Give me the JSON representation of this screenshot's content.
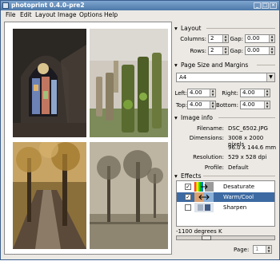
{
  "window": {
    "title": "photoprint 0.4.0-pre2",
    "buttons": {
      "minimize": "_",
      "maximize": "□",
      "close": "×"
    }
  },
  "menu": [
    "File",
    "Edit",
    "Layout",
    "Image",
    "Options",
    "Help"
  ],
  "photos": [
    {
      "caption": "stained glass window"
    },
    {
      "caption": "mossy wooden posts"
    },
    {
      "caption": "autumn woodland path"
    },
    {
      "caption": "sepia trees"
    }
  ],
  "layout": {
    "title": "Layout",
    "columns_label": "Columns:",
    "columns_value": "2",
    "rows_label": "Rows:",
    "rows_value": "2",
    "gap1_label": "Gap:",
    "gap1_value": "0.00",
    "gap2_label": "Gap:",
    "gap2_value": "0.00"
  },
  "page_size": {
    "title": "Page Size and Margins",
    "paper": "A4",
    "left_label": "Left:",
    "left_value": "4.00",
    "right_label": "Right:",
    "right_value": "4.00",
    "top_label": "Top:",
    "top_value": "4.00",
    "bottom_label": "Bottom:",
    "bottom_value": "4.00"
  },
  "image_info": {
    "title": "Image info",
    "filename_label": "Filename:",
    "filename": "DSC_6502.JPG",
    "dimensions_label": "Dimensions:",
    "dimensions_px": "3008 x 2000 pixels",
    "dimensions_mm": "96.0 x 144.6 mm",
    "resolution_label": "Resolution:",
    "resolution": "529 x 528 dpi",
    "profile_label": "Profile:",
    "profile": "Default"
  },
  "effects": {
    "title": "Effects",
    "items": [
      {
        "name": "Desaturate",
        "checked": true,
        "selected": false
      },
      {
        "name": "Warm/Cool",
        "checked": true,
        "selected": true
      },
      {
        "name": "Sharpen",
        "checked": false,
        "selected": false
      }
    ],
    "param_label": "-1100 degrees K",
    "slider_level": 0.28
  },
  "footer": {
    "page_label": "Page:",
    "page_value": "1"
  },
  "colors": {
    "titlebar": "#5a84b4",
    "selection": "#3d6aa3",
    "window_bg": "#ece9e4"
  }
}
